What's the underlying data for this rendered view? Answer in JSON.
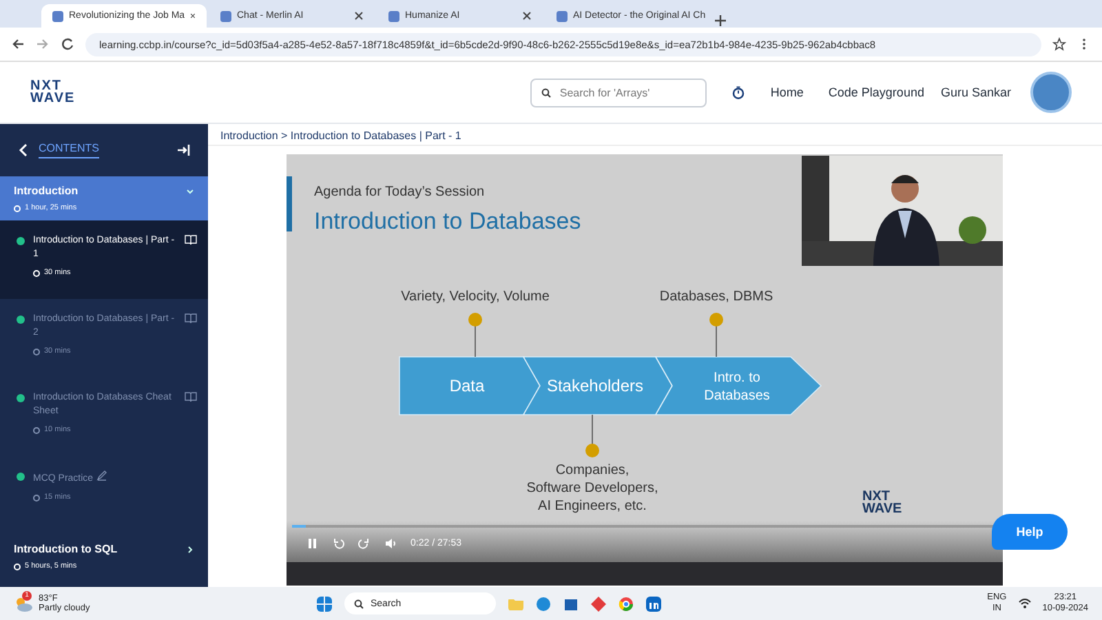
{
  "browser": {
    "tabs": [
      {
        "title": "Revolutionizing the Job Ma",
        "selected": true
      },
      {
        "title": "Chat - Merlin AI",
        "selected": false
      },
      {
        "title": "Humanize AI",
        "selected": false
      },
      {
        "title": "AI Detector - the Original AI Ch",
        "selected": false
      }
    ],
    "url": "learning.ccbp.in/course?c_id=5d03f5a4-a285-4e52-8a57-18f718c4859f&t_id=6b5cde2d-9f90-48c6-b262-2555c5d19e8e&s_id=ea72b1b4-984e-4235-9b25-962ab4cbbac8"
  },
  "header": {
    "logo": [
      "NXT",
      "WAVE"
    ],
    "search": {
      "placeholder": "Search for 'Arrays'"
    },
    "nav": [
      "Home",
      "Code Playground"
    ],
    "user": "Guru Sankar"
  },
  "sidebar": {
    "title": "CONTENTS",
    "sections": [
      {
        "title": "Introduction",
        "duration": "1 hour, 25 mins",
        "expanded": true,
        "items": [
          {
            "kind": "reading",
            "title": "Introduction to Databases | Part - 1",
            "duration": "30 mins",
            "completed": true,
            "selected": true
          },
          {
            "kind": "reading",
            "title": "Introduction to Databases | Part - 2",
            "duration": "30 mins",
            "completed": true,
            "selected": false
          },
          {
            "kind": "reading",
            "title": "Introduction to Databases Cheat Sheet",
            "duration": "10 mins",
            "completed": true,
            "selected": false
          },
          {
            "kind": "practice",
            "title": "MCQ Practice",
            "duration": "15 mins",
            "completed": true,
            "selected": false
          }
        ]
      },
      {
        "title": "Introduction to SQL",
        "duration": "5 hours, 5 mins",
        "expanded": false
      }
    ]
  },
  "breadcrumb": "Introduction > Introduction to Databases | Part - 1",
  "video": {
    "slide": {
      "subtitle": "Agenda for Today’s Session",
      "title": "Introduction to Databases",
      "stages": [
        "Data",
        "Stakeholders",
        "Intro. to Databases"
      ],
      "callouts_above": [
        "Variety, Velocity, Volume",
        "Databases, DBMS"
      ],
      "callouts_below": [
        "Companies, Software Developers, AI Engineers, etc."
      ]
    },
    "logo": [
      "NXT",
      "WAVE"
    ],
    "player": {
      "time": "0:22 / 27:53",
      "level": 0.02
    }
  },
  "help": "Help",
  "taskbar": {
    "weather": {
      "badge": "1",
      "temp": "83°F",
      "condition": "Partly cloudy"
    },
    "search": "Search",
    "lang": [
      "ENG",
      "IN"
    ],
    "time": "23:21",
    "date": "10-09-2024"
  }
}
